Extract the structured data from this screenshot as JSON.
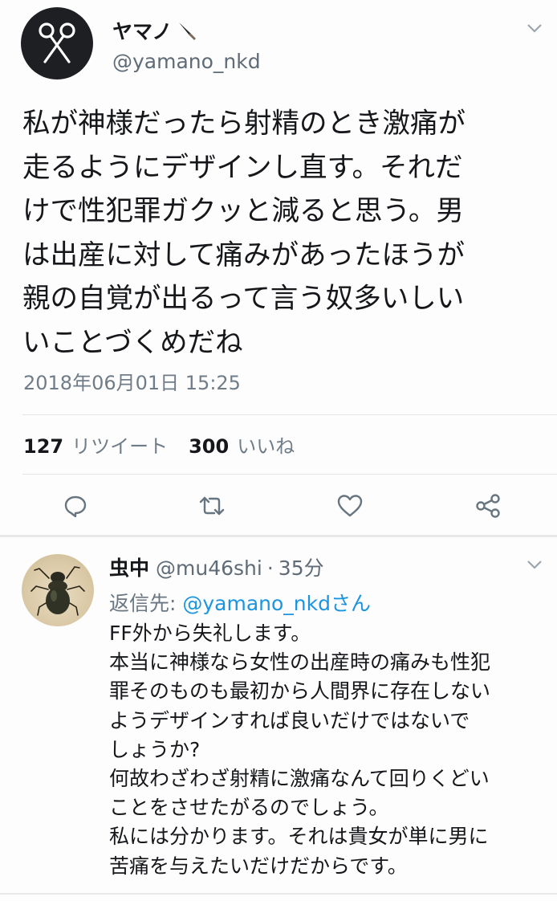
{
  "tweet": {
    "display_name": "ヤマノ",
    "handle": "@yamano_nkd",
    "text_lines": [
      "私が神様だったら射精のとき激痛が",
      "走るようにデザインし直す。それだ",
      "けで性犯罪ガクッと減ると思う。男",
      "は出産に対して痛みがあったほうが",
      "親の自覚が出るって言う奴多いしい",
      "いことづくめだね"
    ],
    "timestamp": "2018年06月01日 15:25",
    "retweet_count": "127",
    "retweet_label": "リツイート",
    "like_count": "300",
    "like_label": "いいね",
    "actions": [
      "reply-icon",
      "retweet-icon",
      "heart-icon",
      "share-icon"
    ]
  },
  "reply": {
    "display_name": "虫中",
    "handle": "@mu46shi",
    "separator": "·",
    "time_ago": "35分",
    "reply_to_prefix": "返信先: ",
    "reply_to_handle": "@yamano_nkdさん",
    "text_lines": [
      "FF外から失礼します。",
      "本当に神様なら女性の出産時の痛みも性犯",
      "罪そのものも最初から人間界に存在しない",
      "ようデザインすれば良いだけではないで",
      "しょうか?",
      "何故わざわざ射精に激痛なんて回りくどい",
      "ことをさせたがるのでしょう。",
      "私には分かります。それは貴女が単に男に",
      "苦痛を与えたいだけだからです。"
    ]
  },
  "colors": {
    "text": "#15171a",
    "secondary": "#5f6b76",
    "link": "#1b95e0",
    "divider": "#e6e8ea"
  }
}
